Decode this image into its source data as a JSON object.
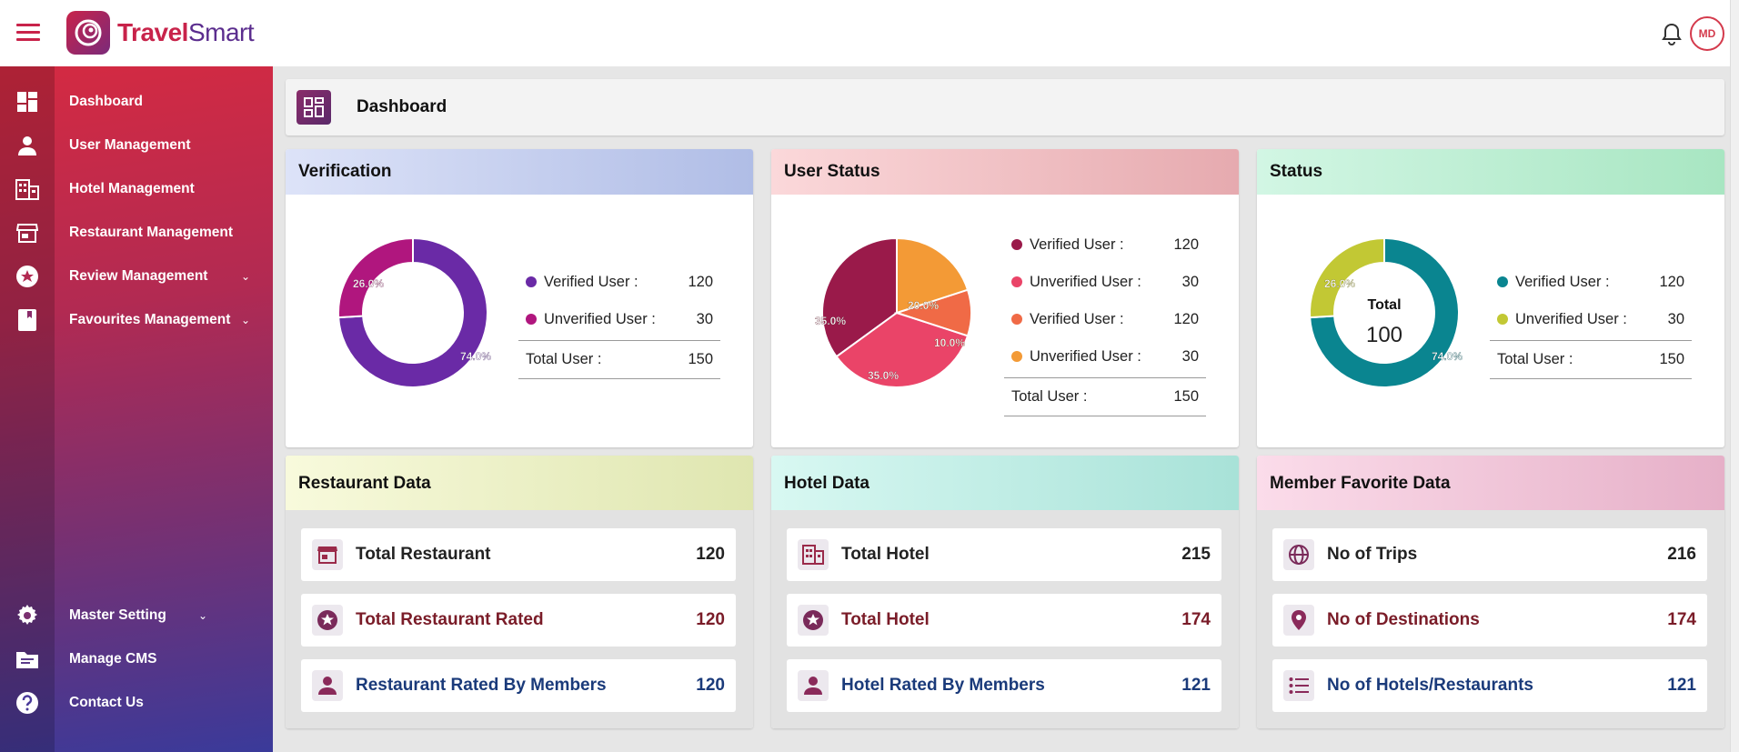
{
  "app": {
    "logo_part1": "Travel",
    "logo_part2": "Smart",
    "user_initials": "MD"
  },
  "colors": {
    "brand_red": "#c8234a",
    "brand_purple": "#5b2d8e",
    "sidebar_top": "#d42a42",
    "sidebar_bottom": "#3a3a9a"
  },
  "sidebar": {
    "items": [
      {
        "label": "Dashboard",
        "icon": "dashboard-icon"
      },
      {
        "label": "User Management",
        "icon": "person-icon"
      },
      {
        "label": "Hotel Management",
        "icon": "building-icon"
      },
      {
        "label": "Restaurant Management",
        "icon": "store-icon"
      },
      {
        "label": "Review Management",
        "icon": "star-circle-icon"
      },
      {
        "label": "Favourites Management",
        "icon": "bookmark-icon"
      }
    ],
    "bottom_items": [
      {
        "label": "Master Setting",
        "icon": "gear-icon"
      },
      {
        "label": "Manage CMS",
        "icon": "folder-icon"
      },
      {
        "label": "Contact Us",
        "icon": "help-icon"
      }
    ]
  },
  "page": {
    "title": "Dashboard"
  },
  "verification": {
    "title": "Verification",
    "legend": [
      {
        "label": "Verified User :",
        "value": "120",
        "color": "#6a2aa6"
      },
      {
        "label": "Unverified User :",
        "value": "30",
        "color": "#b0167e"
      }
    ],
    "total_label": "Total User :",
    "total_value": "150",
    "pct_labels": [
      "74.0%",
      "26.0%"
    ]
  },
  "user_status": {
    "title": "User Status",
    "legend": [
      {
        "label": "Verified User :",
        "value": "120",
        "color": "#9a1a4a"
      },
      {
        "label": "Unverified User :",
        "value": "30",
        "color": "#ea4468"
      },
      {
        "label": "Verified User :",
        "value": "120",
        "color": "#f06a46"
      },
      {
        "label": "Unverified User :",
        "value": "30",
        "color": "#f39a36"
      }
    ],
    "total_label": "Total User :",
    "total_value": "150",
    "pct_labels": [
      "35.0%",
      "35.0%",
      "10.0%",
      "20.0%"
    ]
  },
  "status": {
    "title": "Status",
    "center_label": "Total",
    "center_value": "100",
    "legend": [
      {
        "label": "Verified User :",
        "value": "120",
        "color": "#0a8590"
      },
      {
        "label": "Unverified User :",
        "value": "30",
        "color": "#c2c834"
      }
    ],
    "total_label": "Total User :",
    "total_value": "150",
    "pct_labels": [
      "74.0%",
      "26.0%"
    ]
  },
  "chart_data": [
    {
      "type": "pie",
      "title": "Verification",
      "categories": [
        "Verified User",
        "Unverified User"
      ],
      "values": [
        74.0,
        26.0
      ],
      "donut": true
    },
    {
      "type": "pie",
      "title": "User Status",
      "categories": [
        "Verified User",
        "Unverified User",
        "Verified User",
        "Unverified User"
      ],
      "values": [
        35.0,
        35.0,
        10.0,
        20.0
      ],
      "donut": false
    },
    {
      "type": "pie",
      "title": "Status",
      "categories": [
        "Verified User",
        "Unverified User"
      ],
      "values": [
        74.0,
        26.0
      ],
      "donut": true
    }
  ],
  "restaurant_data": {
    "title": "Restaurant Data",
    "rows": [
      {
        "label": "Total Restaurant",
        "value": "120",
        "icon": "store-icon"
      },
      {
        "label": "Total Restaurant Rated",
        "value": "120",
        "icon": "star-circle-icon"
      },
      {
        "label": "Restaurant Rated By Members",
        "value": "120",
        "icon": "person-icon"
      }
    ]
  },
  "hotel_data": {
    "title": "Hotel Data",
    "rows": [
      {
        "label": "Total Hotel",
        "value": "215",
        "icon": "building-icon"
      },
      {
        "label": "Total Hotel",
        "value": "174",
        "icon": "star-circle-icon"
      },
      {
        "label": "Hotel Rated By Members",
        "value": "121",
        "icon": "person-icon"
      }
    ]
  },
  "member_favorite": {
    "title": "Member Favorite Data",
    "rows": [
      {
        "label": "No of Trips",
        "value": "216",
        "icon": "globe-icon"
      },
      {
        "label": "No of Destinations",
        "value": "174",
        "icon": "location-pin-icon"
      },
      {
        "label": "No of Hotels/Restaurants",
        "value": "121",
        "icon": "list-icon"
      }
    ]
  }
}
